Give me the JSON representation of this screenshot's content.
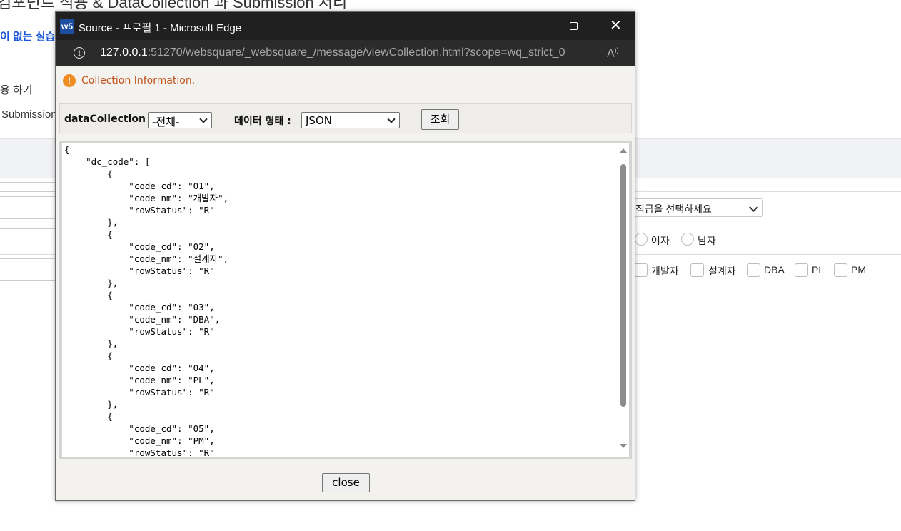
{
  "background_page": {
    "title": "컴포넌트 적용 & DataCollection 과 Submission 처리",
    "link_text": "이 없는 실습",
    "text_line_1": "용 하기",
    "text_line_2": "Submission",
    "rank_select_value": "직급을 선택하세요",
    "gender_options": [
      "여자",
      "남자"
    ],
    "role_options": [
      "개발자",
      "설계자",
      "DBA",
      "PL",
      "PM"
    ]
  },
  "window": {
    "app_icon_text": "w5",
    "title": "Source - 프로필 1 - Microsoft Edge",
    "address": {
      "host": "127.0.0.1",
      "rest": ":51270/websquare/_websquare_/message/viewCollection.html?scope=wq_strict_0"
    }
  },
  "dialog": {
    "message": "Collection Information.",
    "data_collection_label": "dataCollection :",
    "data_collection_value": "-전체-",
    "data_format_label": "데이터 형태 :",
    "data_format_value": "JSON",
    "query_button": "조회",
    "close_button": "close",
    "json_text": "{\n    \"dc_code\": [\n        {\n            \"code_cd\": \"01\",\n            \"code_nm\": \"개발자\",\n            \"rowStatus\": \"R\"\n        },\n        {\n            \"code_cd\": \"02\",\n            \"code_nm\": \"설계자\",\n            \"rowStatus\": \"R\"\n        },\n        {\n            \"code_cd\": \"03\",\n            \"code_nm\": \"DBA\",\n            \"rowStatus\": \"R\"\n        },\n        {\n            \"code_cd\": \"04\",\n            \"code_nm\": \"PL\",\n            \"rowStatus\": \"R\"\n        },\n        {\n            \"code_cd\": \"05\",\n            \"code_nm\": \"PM\",\n            \"rowStatus\": \"R\""
  }
}
